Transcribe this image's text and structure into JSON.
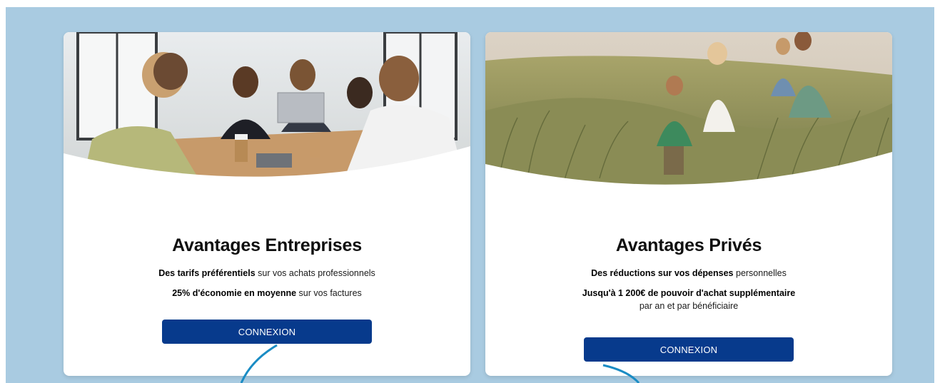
{
  "cards": {
    "enterprise": {
      "title": "Avantages Entreprises",
      "line1_bold": "Des tarifs préférentiels",
      "line1_rest": " sur vos achats professionnels",
      "line2_bold": "25% d'économie en moyenne",
      "line2_rest": " sur vos factures",
      "button": "CONNEXION"
    },
    "private": {
      "title": "Avantages Privés",
      "line1_bold": "Des réductions sur vos dépenses",
      "line1_rest": " personnelles",
      "line2_bold": "Jusqu'à 1 200€ de pouvoir d'achat supplémentaire",
      "line3": "par an et par bénéficiaire",
      "button": "CONNEXION"
    }
  },
  "colors": {
    "background": "#a9cbe1",
    "button": "#073a8c",
    "accent_arc": "#1a8cc4"
  }
}
